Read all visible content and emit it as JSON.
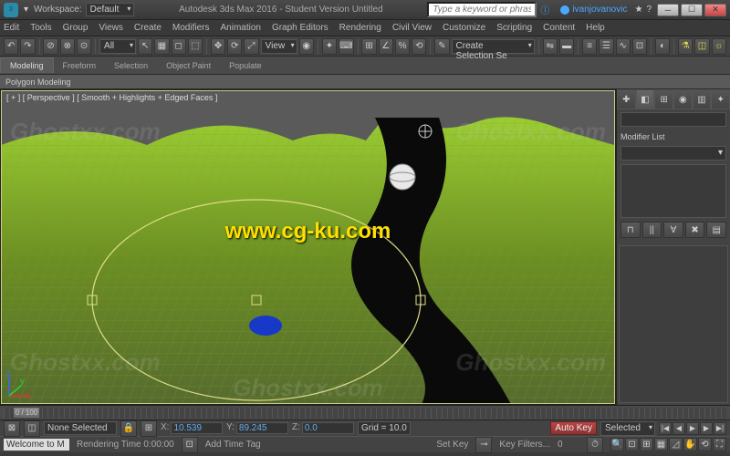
{
  "title": "Autodesk 3ds Max 2016 - Student Version   Untitled",
  "workspace_label": "Workspace:",
  "workspace_value": "Default",
  "search_placeholder": "Type a keyword or phrase",
  "user": "ivanjovanovic",
  "menus": [
    "Edit",
    "Tools",
    "Group",
    "Views",
    "Create",
    "Modifiers",
    "Animation",
    "Graph Editors",
    "Rendering",
    "Civil View",
    "Customize",
    "Scripting",
    "Content",
    "Help"
  ],
  "toolbar1": {
    "all": "All",
    "view": "View",
    "create_set": "Create Selection Se"
  },
  "ribbon_tabs": [
    "Modeling",
    "Freeform",
    "Selection",
    "Object Paint",
    "Populate"
  ],
  "ribbon_sub": "Polygon Modeling",
  "viewport_label": "[ + ] [ Perspective ] [ Smooth + Highlights + Edged Faces ]",
  "cmdpanel": {
    "modifier_label": "Modifier List"
  },
  "timeline": {
    "frame": "0 / 100"
  },
  "status": {
    "none": "None Selected",
    "x": "10.539",
    "y": "89.245",
    "z": "0.0",
    "grid": "Grid = 10.0",
    "autokey": "Auto Key",
    "selected": "Selected"
  },
  "status2": {
    "prompt": "Welcome to M",
    "render_time": "Rendering Time  0:00:00",
    "time_tag": "Add Time Tag",
    "setkey": "Set Key",
    "filters": "Key Filters..."
  },
  "watermark": "Ghostxx.com",
  "url": "www.cg-ku.com"
}
